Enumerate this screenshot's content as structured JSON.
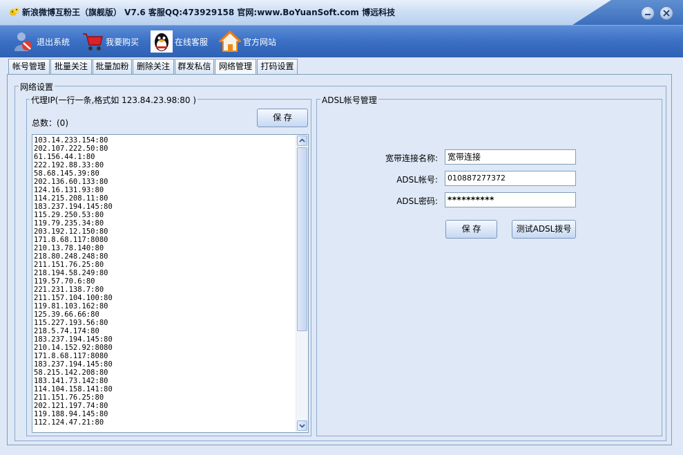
{
  "window": {
    "title": "新浪微博互粉王（旗舰版） V7.6 客服QQ:473929158 官网:www.BoYuanSoft.com 博远科技"
  },
  "toolbar": {
    "items": [
      {
        "label": "退出系统",
        "icon": "exit-user-icon"
      },
      {
        "label": "我要购买",
        "icon": "shopping-cart-icon"
      },
      {
        "label": "在线客服",
        "icon": "qq-penguin-icon"
      },
      {
        "label": "官方网站",
        "icon": "home-icon"
      }
    ]
  },
  "tabs": [
    {
      "label": "帐号管理",
      "active": false
    },
    {
      "label": "批量关注",
      "active": false
    },
    {
      "label": "批量加粉",
      "active": false
    },
    {
      "label": "删除关注",
      "active": false
    },
    {
      "label": "群发私信",
      "active": false
    },
    {
      "label": "网络管理",
      "active": true
    },
    {
      "label": "打码设置",
      "active": false
    }
  ],
  "network": {
    "group_title": "网络设置",
    "proxy": {
      "group_title": "代理IP(一行一条,格式如  123.84.23.98:80 )",
      "count_label": "总数：(0)",
      "save_label": "保   存",
      "ips": [
        "103.14.233.154:80",
        "202.107.222.50:80",
        "61.156.44.1:80",
        "222.192.88.33:80",
        "58.68.145.39:80",
        "202.136.60.133:80",
        "124.16.131.93:80",
        "114.215.208.11:80",
        "183.237.194.145:80",
        "115.29.250.53:80",
        "119.79.235.34:80",
        "203.192.12.150:80",
        "171.8.68.117:8080",
        "210.13.78.140:80",
        "218.80.248.248:80",
        "211.151.76.25:80",
        "218.194.58.249:80",
        "119.57.70.6:80",
        "221.231.138.7:80",
        "211.157.104.100:80",
        "119.81.103.162:80",
        "125.39.66.66:80",
        "115.227.193.56:80",
        "218.5.74.174:80",
        "183.237.194.145:80",
        "210.14.152.92:8080",
        "171.8.68.117:8080",
        "183.237.194.145:80",
        "58.215.142.208:80",
        "183.141.73.142:80",
        "114.104.158.141:80",
        "211.151.76.25:80",
        "202.121.197.74:80",
        "119.188.94.145:80",
        "112.124.47.21:80"
      ]
    },
    "adsl": {
      "group_title": "ADSL帐号管理",
      "conn_name_label": "宽带连接名称:",
      "conn_name_value": "宽带连接",
      "account_label": "ADSL帐号:",
      "account_value": "010887277372",
      "password_label": "ADSL密码:",
      "password_value": "**********",
      "save_label": "保  存",
      "test_label": "测试ADSL拨号"
    }
  },
  "colors": {
    "toolbar_bg": "#3a6fc4",
    "panel_bg": "#dfe8f6",
    "border": "#7f9db9"
  }
}
